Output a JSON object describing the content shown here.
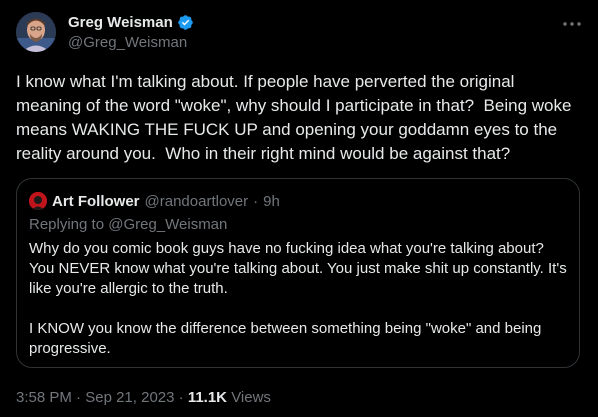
{
  "author": {
    "display_name": "Greg Weisman",
    "handle": "@Greg_Weisman",
    "verified_icon": "verified-badge-icon"
  },
  "tweet": {
    "text": "I know what I'm talking about. If people have perverted the original meaning of the word \"woke\", why should I participate in that?  Being woke means WAKING THE FUCK UP and opening your goddamn eyes to the reality around you.  Who in their right mind would be against that?"
  },
  "quote": {
    "display_name": "Art Follower",
    "handle": "@randoartlover",
    "separator": "·",
    "time": "9h",
    "replying_to": "Replying to @Greg_Weisman",
    "text": "Why do you comic book guys have no fucking idea what you're talking about? You NEVER know what you're talking about. You just make shit up constantly. It's like you're allergic to the truth.\n\nI KNOW you know the difference between something being \"woke\" and being progressive."
  },
  "meta": {
    "time": "3:58 PM",
    "separator1": "·",
    "date": "Sep 21, 2023",
    "separator2": "·",
    "views_count": "11.1K",
    "views_label": "Views"
  },
  "colors": {
    "background": "#000000",
    "text": "#e7e9ea",
    "secondary": "#71767b",
    "border": "#2f3336",
    "verified": "#1d9bf0"
  }
}
